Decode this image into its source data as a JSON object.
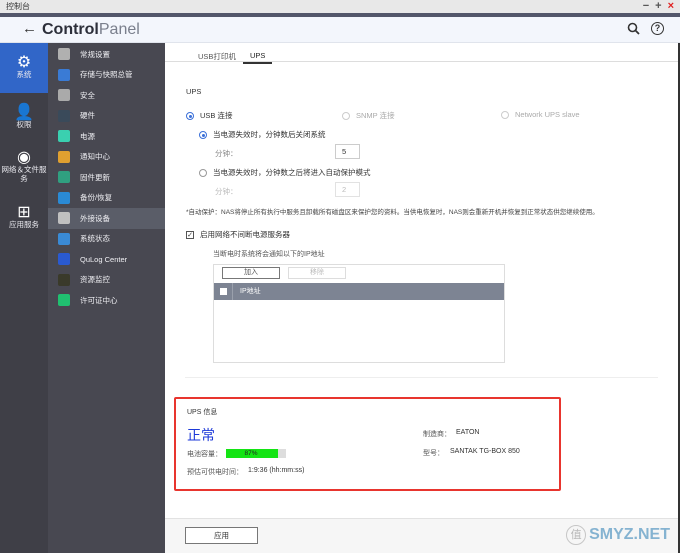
{
  "window": {
    "title": "控制台",
    "minimize": "−",
    "maximize": "+",
    "close": "×"
  },
  "header": {
    "back": "←",
    "title_bold": "Control",
    "title_light": "Panel",
    "search_icon": "search-icon",
    "help_icon": "help-icon"
  },
  "nav_primary": [
    {
      "label": "系统",
      "icon": "gear-icon",
      "glyph": "⚙",
      "active": true
    },
    {
      "label": "权限",
      "icon": "user-icon",
      "glyph": "👤",
      "active": false
    },
    {
      "label": "网络＆文件服务",
      "icon": "globe-icon",
      "glyph": "◉",
      "active": false
    },
    {
      "label": "应用服务",
      "icon": "apps-icon",
      "glyph": "⊞",
      "active": false
    }
  ],
  "nav_secondary": [
    {
      "label": "常规设置",
      "color": "#b0b0b0",
      "active": false
    },
    {
      "label": "存储与快照总管",
      "color": "#3a7bd5",
      "active": false
    },
    {
      "label": "安全",
      "color": "#aaaaaa",
      "active": false
    },
    {
      "label": "硬件",
      "color": "#3a4a5a",
      "active": false
    },
    {
      "label": "电源",
      "color": "#3ad0b0",
      "active": false
    },
    {
      "label": "通知中心",
      "color": "#e0a030",
      "active": false
    },
    {
      "label": "固件更新",
      "color": "#30a080",
      "active": false
    },
    {
      "label": "备份/恢复",
      "color": "#2a8ad5",
      "active": false
    },
    {
      "label": "外接设备",
      "color": "#c0c0c0",
      "active": true
    },
    {
      "label": "系统状态",
      "color": "#3a8ad5",
      "active": false
    },
    {
      "label": "QuLog Center",
      "color": "#2a5ad0",
      "active": false
    },
    {
      "label": "资源监控",
      "color": "#3a3a2a",
      "active": false
    },
    {
      "label": "许可证中心",
      "color": "#20c070",
      "active": false
    }
  ],
  "tabs": [
    {
      "label": "USB打印机",
      "active": false
    },
    {
      "label": "UPS",
      "active": true
    }
  ],
  "ups": {
    "section_title": "UPS",
    "conn_usb": "USB 连接",
    "conn_snmp": "SNMP 连接",
    "conn_network": "Network UPS slave",
    "opt_shutdown": "当电源失效时，分钟数后关闭系统",
    "minutes_label": "分钟：",
    "shutdown_minutes": "5",
    "opt_protect": "当电源失效时，分钟数之后将进入自动保护模式",
    "protect_minutes": "2",
    "note": "*自动保护：NAS将停止所有执行中服务且卸载所有磁盘区来保护您的资料。当供电恢复时，NAS则会重新开机并恢复到正常状态供您继续使用。",
    "enable_server": "启用网络不间断电源服务器",
    "notify_text": "当断电时系统将会通知以下的IP地址",
    "add_button": "加入",
    "remove_button": "移除",
    "ip_column": "IP地址"
  },
  "ups_info": {
    "title": "UPS 信息",
    "status": "正常",
    "battery_label": "电池容量：",
    "battery_percent": 87,
    "battery_text": "87%",
    "runtime_label": "预估可供电时间：",
    "runtime_value": "1:9:36 (hh:mm:ss)",
    "manufacturer_label": "制造商：",
    "manufacturer": "EATON",
    "model_label": "型号：",
    "model": "SANTAK TG-BOX 850"
  },
  "footer": {
    "apply": "应用",
    "watermark_badge": "值",
    "watermark": "SMYZ.NET"
  }
}
